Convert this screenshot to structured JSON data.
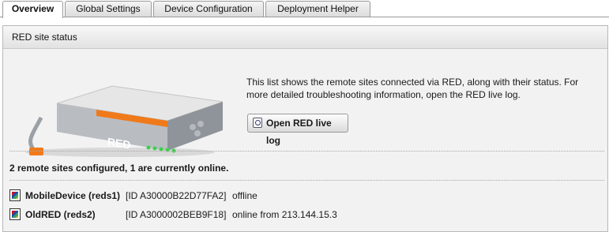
{
  "tabs": [
    {
      "label": "Overview",
      "active": true
    },
    {
      "label": "Global Settings",
      "active": false
    },
    {
      "label": "Device Configuration",
      "active": false
    },
    {
      "label": "Deployment Helper",
      "active": false
    }
  ],
  "panel": {
    "title": "RED site status",
    "device_label": "RED",
    "description": "This list shows the remote sites connected via RED, along with their status. For more detailed troubleshooting information, open the RED live log.",
    "open_log_button": "Open RED live log",
    "summary": "2 remote sites configured, 1 are currently online."
  },
  "sites": [
    {
      "name": "MobileDevice (reds1)",
      "id": "[ID A30000B22D77FA2]",
      "status": "offline"
    },
    {
      "name": "OldRED (reds2)",
      "id": "[ID A3000002BEB9F18]",
      "status": "online from 213.144.15.3"
    }
  ],
  "colors": {
    "accent": "#f07a1a",
    "led": "#3fcf4f"
  }
}
